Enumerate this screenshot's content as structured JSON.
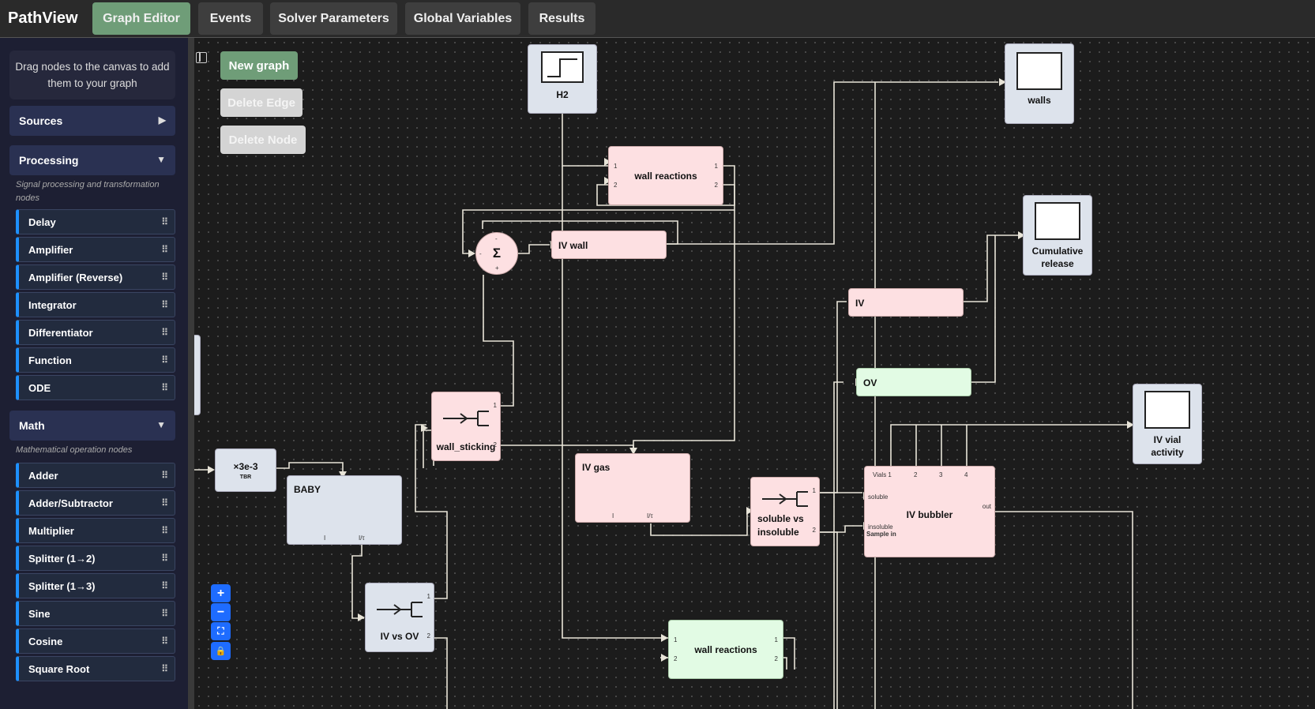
{
  "app": {
    "title": "PathView"
  },
  "tabs": [
    {
      "label": "Graph Editor",
      "active": true
    },
    {
      "label": "Events",
      "active": false
    },
    {
      "label": "Solver Parameters",
      "active": false
    },
    {
      "label": "Global Variables",
      "active": false
    },
    {
      "label": "Results",
      "active": false
    }
  ],
  "sidebar": {
    "hint": "Drag nodes to the canvas to add them to your graph",
    "sources": {
      "label": "Sources",
      "expanded": false
    },
    "processing": {
      "label": "Processing",
      "expanded": true,
      "description": "Signal processing and transformation nodes",
      "items": [
        "Delay",
        "Amplifier",
        "Amplifier (Reverse)",
        "Integrator",
        "Differentiator",
        "Function",
        "ODE"
      ]
    },
    "math": {
      "label": "Math",
      "expanded": true,
      "description": "Mathematical operation nodes",
      "items": [
        "Adder",
        "Adder/Subtractor",
        "Multiplier",
        "Splitter (1→2)",
        "Splitter (1→3)",
        "Sine",
        "Cosine",
        "Square Root"
      ]
    }
  },
  "canvas": {
    "buttons": {
      "new_graph": "New graph",
      "delete_edge": "Delete Edge",
      "delete_node": "Delete Node"
    },
    "nodes": {
      "h2": "H2",
      "walls": "walls",
      "wall_reactions_top": "wall reactions",
      "iv_wall": "IV wall",
      "cumulative_release": "Cumulative release",
      "iv": "IV",
      "ov": "OV",
      "iv_vial_activity": "IV vial activity",
      "wall_sticking": "wall_sticking",
      "tbr_value": "×3e-3",
      "tbr_label": "TBR",
      "baby": "BABY",
      "iv_gas": "IV gas",
      "soluble_vs_insoluble": "soluble vs insoluble",
      "iv_bubbler": "IV bubbler",
      "iv_vs_ov": "IV vs OV",
      "wall_reactions_bottom": "wall reactions",
      "sum_symbol": "Σ"
    },
    "ports": {
      "p1": "1",
      "p2": "2",
      "p3": "3",
      "p4": "4",
      "vials1": "Vials 1",
      "soluble": "soluble",
      "insoluble": "insoluble",
      "sample_in": "Sample in",
      "out": "out",
      "i": "I",
      "i_tau": "I/τ",
      "minus": "-",
      "plus": "+"
    },
    "zoom_controls": {
      "zoom_in": "+",
      "zoom_out": "−",
      "fit": "⛶",
      "lock": "🔒"
    }
  },
  "colors": {
    "active_tab": "#6f9d78",
    "accent_blue": "#1e6cff",
    "node_pink": "#fde0e2",
    "node_green": "#e2fbe4",
    "node_blue": "#dde3ec"
  }
}
